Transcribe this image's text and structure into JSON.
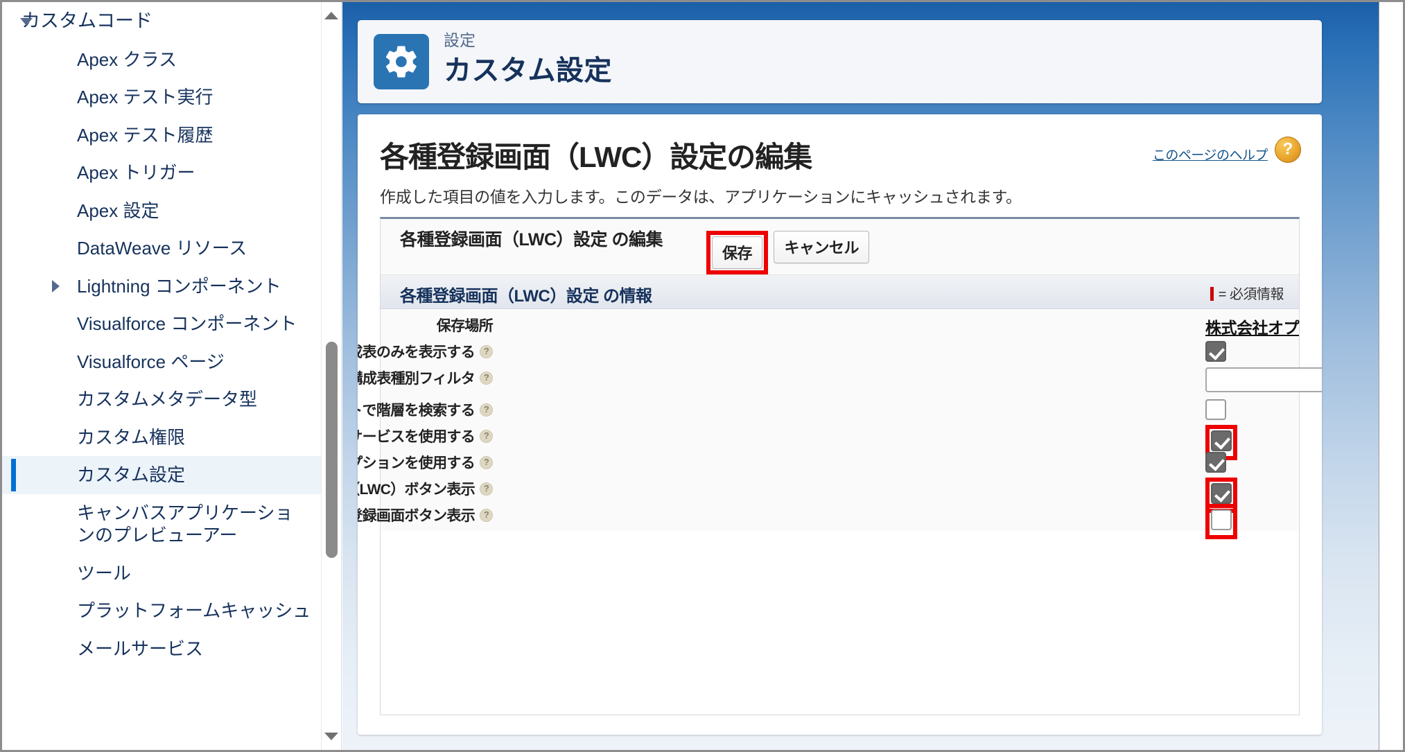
{
  "sidebar": {
    "items": [
      {
        "label": "カスタムコード",
        "level": 0,
        "caret": "down",
        "active": false
      },
      {
        "label": "Apex クラス",
        "level": 1,
        "caret": "",
        "active": false
      },
      {
        "label": "Apex テスト実行",
        "level": 1,
        "caret": "",
        "active": false
      },
      {
        "label": "Apex テスト履歴",
        "level": 1,
        "caret": "",
        "active": false
      },
      {
        "label": "Apex トリガー",
        "level": 1,
        "caret": "",
        "active": false
      },
      {
        "label": "Apex 設定",
        "level": 1,
        "caret": "",
        "active": false
      },
      {
        "label": "DataWeave リソース",
        "level": 1,
        "caret": "",
        "active": false
      },
      {
        "label": "Lightning コンポーネント",
        "level": 1,
        "caret": "right",
        "active": false
      },
      {
        "label": "Visualforce コンポーネント",
        "level": 1,
        "caret": "",
        "active": false
      },
      {
        "label": "Visualforce ページ",
        "level": 1,
        "caret": "",
        "active": false
      },
      {
        "label": "カスタムメタデータ型",
        "level": 1,
        "caret": "",
        "active": false
      },
      {
        "label": "カスタム権限",
        "level": 1,
        "caret": "",
        "active": false
      },
      {
        "label": "カスタム設定",
        "level": 1,
        "caret": "",
        "active": true
      },
      {
        "label": "キャンバスアプリケーションのプレビューアー",
        "level": 1,
        "caret": "",
        "active": false,
        "wrap": true
      },
      {
        "label": "ツール",
        "level": 1,
        "caret": "",
        "active": false
      },
      {
        "label": "プラットフォームキャッシュ",
        "level": 1,
        "caret": "",
        "active": false
      },
      {
        "label": "メールサービス",
        "level": 1,
        "caret": "",
        "active": false
      }
    ],
    "scroll_up_icon": "triangle-up-icon",
    "scroll_down_icon": "triangle-down-icon"
  },
  "header": {
    "eyebrow": "設定",
    "title": "カスタム設定",
    "icon": "gear-icon",
    "icon_bg": "#2a74b4"
  },
  "page": {
    "title": "各種登録画面（LWC）設定の編集",
    "description": "作成した項目の値を入力します。このデータは、アプリケーションにキャッシュされます。",
    "help_link": "このページのヘルプ",
    "help_badge": "?"
  },
  "panel": {
    "title": "各種登録画面（LWC）設定 の編集",
    "save_label": "保存",
    "cancel_label": "キャンセル",
    "save_highlighted": true,
    "section_title": "各種登録画面（LWC）設定 の情報",
    "required_note": "= 必須情報",
    "required_color": "#cc0000",
    "highlight_color": "#ee0000"
  },
  "fields": [
    {
      "label": "保存場所",
      "help": false,
      "type": "link",
      "value": "株式会社オプロ",
      "highlighted": false
    },
    {
      "label": "有効な構成表のみを表示する",
      "help": true,
      "type": "checkbox",
      "checked": true,
      "highlighted": false
    },
    {
      "label": "構成表種別フィルタ",
      "help": true,
      "type": "text",
      "value": "",
      "placeholder": "",
      "highlighted": false
    },
    {
      "label": "デフォルトで階層を検索する",
      "help": true,
      "type": "checkbox",
      "checked": false,
      "highlighted": false
    },
    {
      "label": "契約種別にサービスを使用する",
      "help": true,
      "type": "checkbox",
      "checked": true,
      "highlighted": true
    },
    {
      "label": "契約種別にサブスクリプションを使用する",
      "help": true,
      "type": "checkbox",
      "checked": true,
      "highlighted": false
    },
    {
      "label": "見積登録（LWC）ボタン表示",
      "help": true,
      "type": "checkbox",
      "checked": true,
      "highlighted": true
    },
    {
      "label": "見積条件登録画面ボタン表示",
      "help": true,
      "type": "checkbox",
      "checked": false,
      "highlighted": true
    }
  ]
}
